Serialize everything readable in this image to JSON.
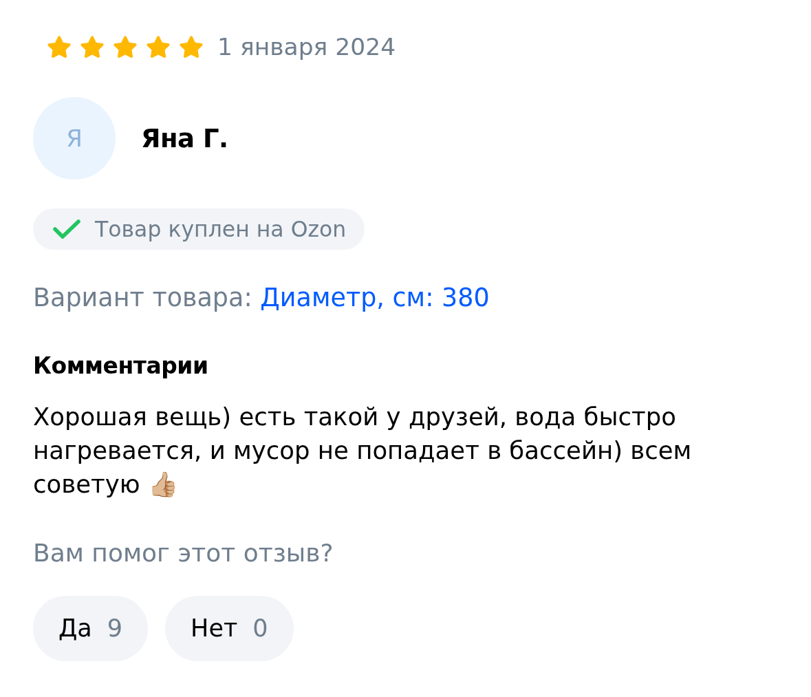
{
  "rating": {
    "stars": 5,
    "date": "1 января 2024"
  },
  "author": {
    "initial": "Я",
    "name": "Яна Г."
  },
  "verified_badge": {
    "text": "Товар куплен на Ozon"
  },
  "variant": {
    "label": "Вариант товара:",
    "value": "Диаметр, см: 380"
  },
  "comments": {
    "heading": "Комментарии",
    "text": "Хорошая вещь) есть такой у друзей, вода быстро нагревается, и мусор не попадает в бассейн) всем советую 👍🏼"
  },
  "helpful": {
    "question": "Вам помог этот отзыв?",
    "buttons": [
      {
        "label": "Да",
        "count": "9"
      },
      {
        "label": "Нет",
        "count": "0"
      }
    ]
  }
}
